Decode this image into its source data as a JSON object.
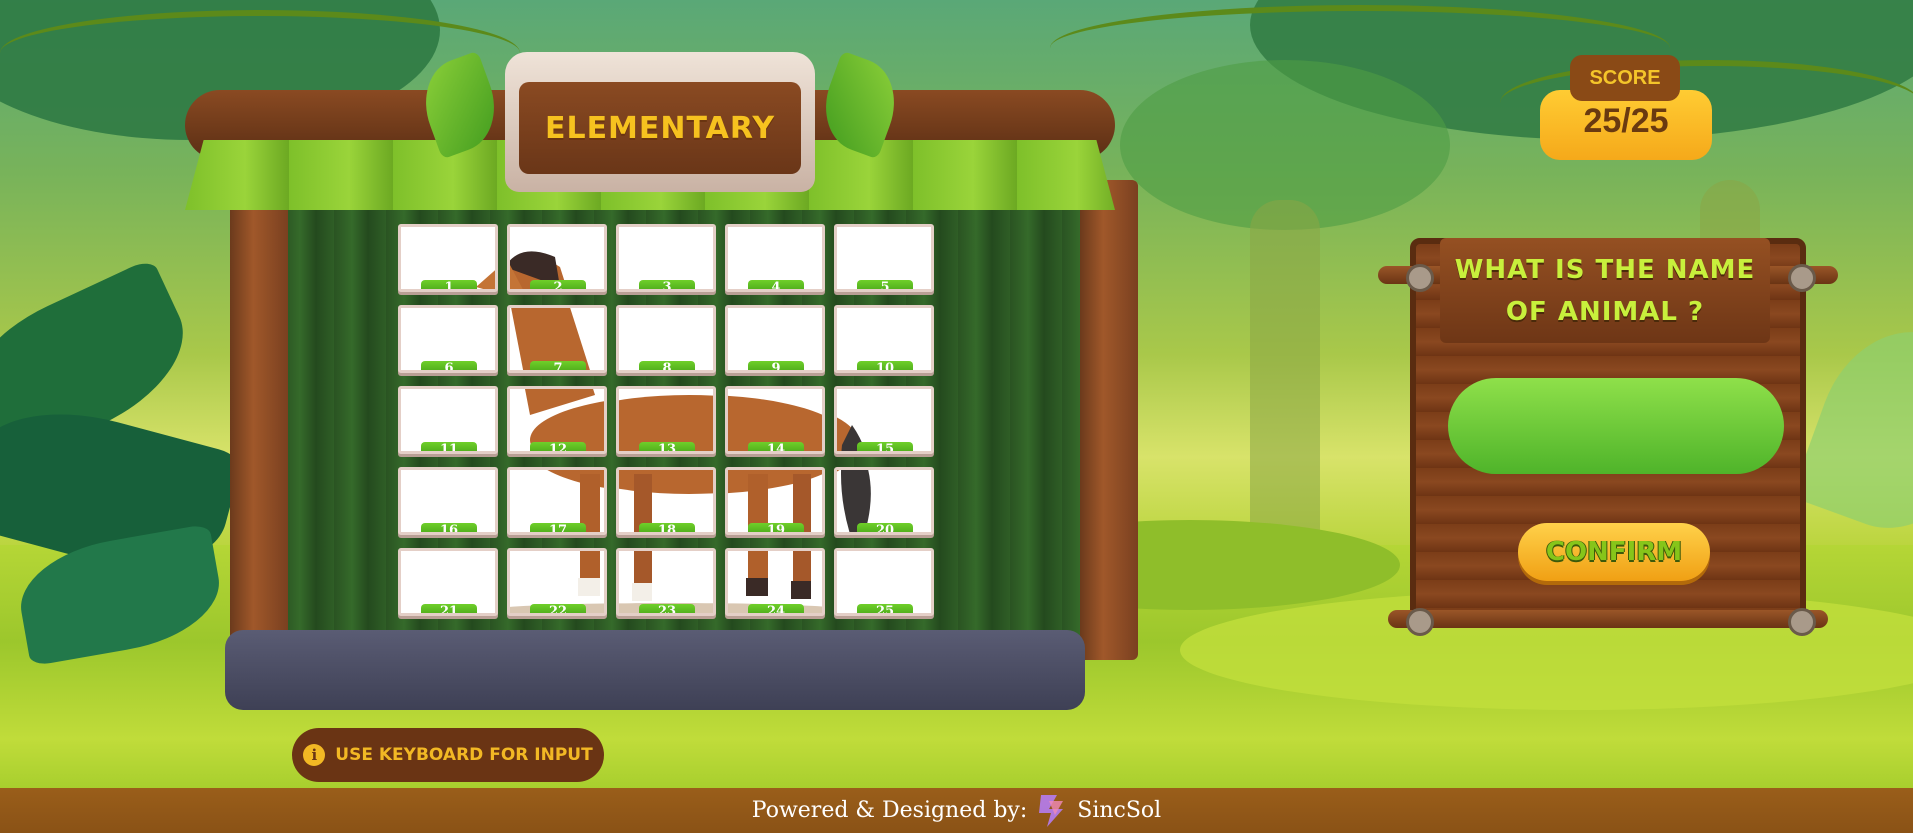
{
  "game": {
    "level_title": "ELEMENTARY",
    "score_label": "SCORE",
    "score_value": "25/25",
    "question": "WHAT IS THE NAME OF ANIMAL ?",
    "answer_value": "",
    "confirm_label": "CONFIRM",
    "hint_text": "USE KEYBOARD FOR INPUT",
    "hint_icon": "info-icon"
  },
  "tiles": [
    "1",
    "2",
    "3",
    "4",
    "5",
    "6",
    "7",
    "8",
    "9",
    "10",
    "11",
    "12",
    "13",
    "14",
    "15",
    "16",
    "17",
    "18",
    "19",
    "20",
    "21",
    "22",
    "23",
    "24",
    "25"
  ],
  "footer": {
    "text": "Powered & Designed by:",
    "brand": "SincSol",
    "logo_icon": "sincsol-logo-icon"
  },
  "colors": {
    "accent_yellow": "#f4c52a",
    "tile_number_green": "#4fb42a",
    "wood_brown": "#7b3d18",
    "footer_brown": "#9a5e1a"
  }
}
